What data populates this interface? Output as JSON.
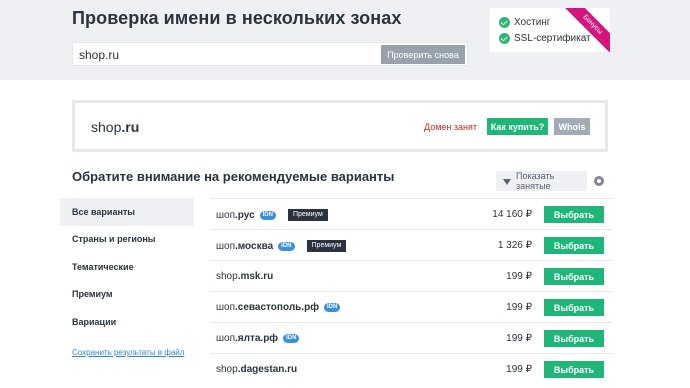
{
  "header": {
    "title": "Проверка имени в нескольких зонах",
    "search_value": "shop.ru",
    "search_button": "Проверить снова"
  },
  "promo": {
    "items": [
      "Хостинг",
      "SSL-сертификат"
    ],
    "ribbon": "Бонусы"
  },
  "result": {
    "name": "shop",
    "zone": ".ru",
    "status": "Домен занят",
    "buy_label": "Как купить?",
    "whois_label": "Whois"
  },
  "recommend": {
    "title": "Обратите внимание на рекомендуемые варианты",
    "filter_label": "Показать занятые"
  },
  "sidebar": {
    "items": [
      "Все варианты",
      "Страны и регионы",
      "Тематические",
      "Премиум",
      "Вариации"
    ],
    "save_link": "Сохранить результаты в файл"
  },
  "domains": [
    {
      "name": "шоп",
      "zone": ".рус",
      "idn": "IDN",
      "premium": "Премиум",
      "price": "14 160 ₽",
      "action": "Выбрать"
    },
    {
      "name": "шоп",
      "zone": ".москва",
      "idn": "IDN",
      "premium": "Премиум",
      "price": "1 326 ₽",
      "action": "Выбрать"
    },
    {
      "name": "shop",
      "zone": ".msk.ru",
      "idn": "",
      "premium": "",
      "price": "199 ₽",
      "action": "Выбрать"
    },
    {
      "name": "шоп",
      "zone": ".севастополь.рф",
      "idn": "IDN",
      "premium": "",
      "price": "199 ₽",
      "action": "Выбрать"
    },
    {
      "name": "шоп",
      "zone": ".ялта.рф",
      "idn": "IDN",
      "premium": "",
      "price": "199 ₽",
      "action": "Выбрать"
    },
    {
      "name": "shop",
      "zone": ".dagestan.ru",
      "idn": "",
      "premium": "",
      "price": "199 ₽",
      "action": "Выбрать"
    }
  ]
}
